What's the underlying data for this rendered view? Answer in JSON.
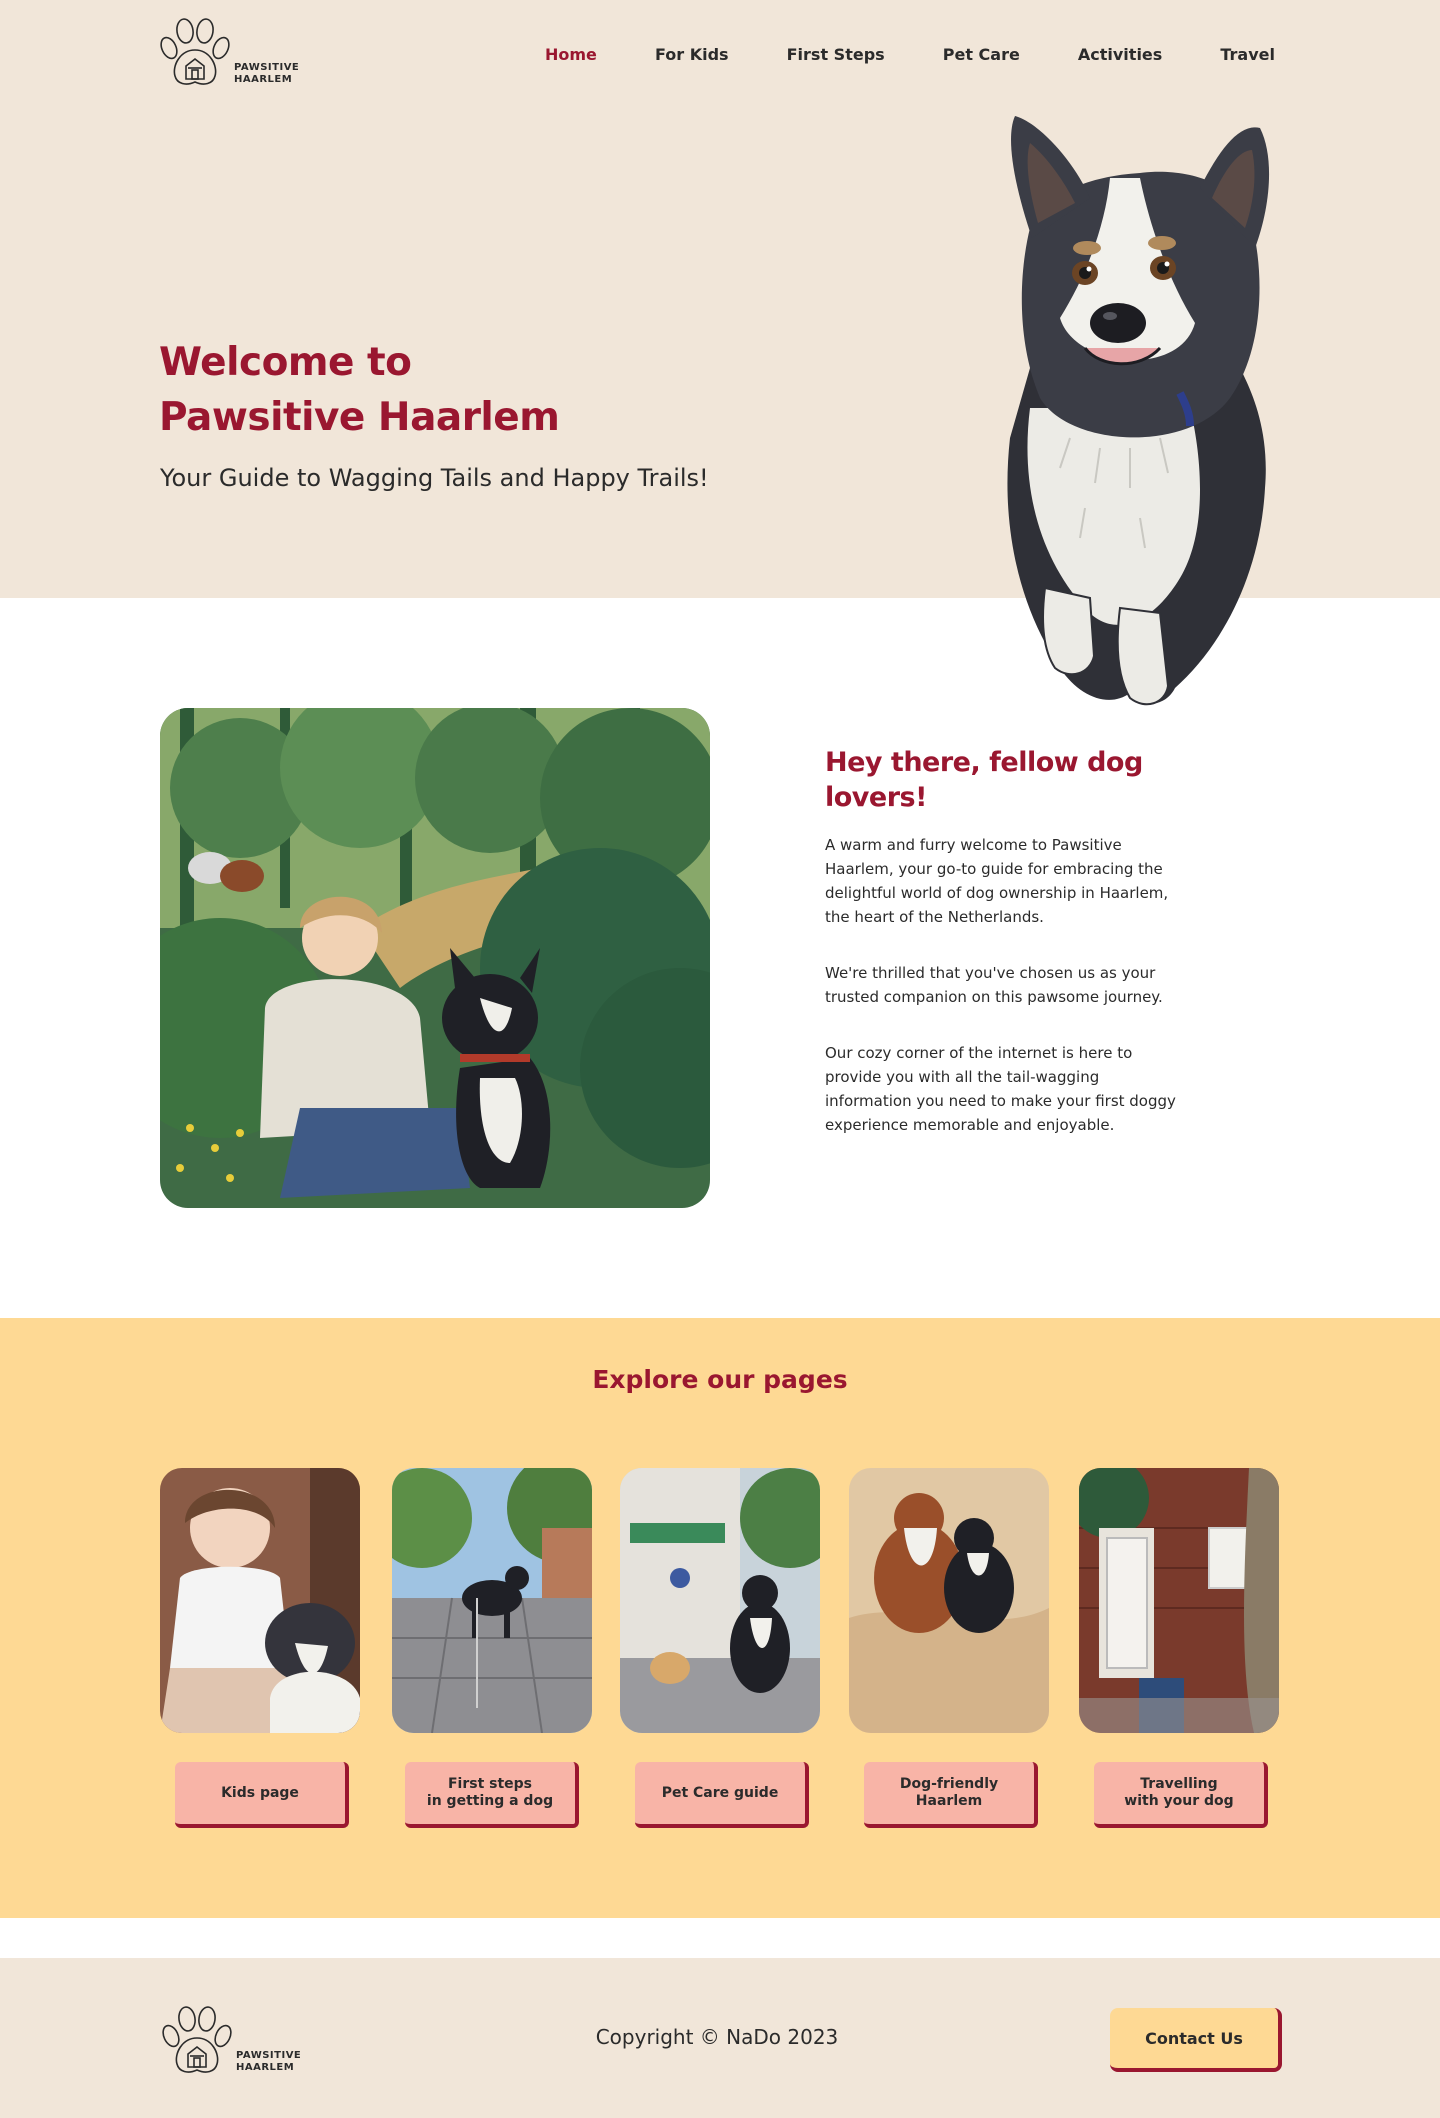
{
  "brand": {
    "logo_line1": "PAWSITIVE",
    "logo_line2": "HAARLEM"
  },
  "nav": {
    "items": [
      {
        "label": "Home",
        "active": true
      },
      {
        "label": "For Kids",
        "active": false
      },
      {
        "label": "First Steps",
        "active": false
      },
      {
        "label": "Pet Care",
        "active": false
      },
      {
        "label": "Activities",
        "active": false
      },
      {
        "label": "Travel",
        "active": false
      }
    ]
  },
  "hero": {
    "title_line1": "Welcome to",
    "title_line2": "Pawsitive Haarlem",
    "subtitle": "Your Guide to Wagging Tails and Happy Trails!"
  },
  "intro": {
    "heading": "Hey there, fellow dog lovers!",
    "paragraphs": [
      "A warm and furry welcome to Pawsitive Haarlem, your go-to guide for embracing the delightful world of dog ownership in Haarlem, the heart of the Netherlands.",
      "We're thrilled that you've chosen us as your trusted companion on this pawsome journey.",
      "Our cozy corner of the internet is here to provide you with all the tail-wagging information you need to make your first doggy experience memorable and enjoyable."
    ]
  },
  "explore": {
    "title": "Explore our pages",
    "cards": [
      {
        "label": "Kids page"
      },
      {
        "label": "First steps\nin getting a dog"
      },
      {
        "label": "Pet Care guide"
      },
      {
        "label": "Dog-friendly\nHaarlem"
      },
      {
        "label": "Travelling\nwith your dog"
      }
    ]
  },
  "footer": {
    "copyright": "Copyright © NaDo 2023",
    "contact_label": "Contact Us"
  },
  "colors": {
    "accent": "#9a1730",
    "hero_bg": "#f1e6d9",
    "explore_bg": "#fed994",
    "card_button_bg": "#f8b4a7"
  }
}
